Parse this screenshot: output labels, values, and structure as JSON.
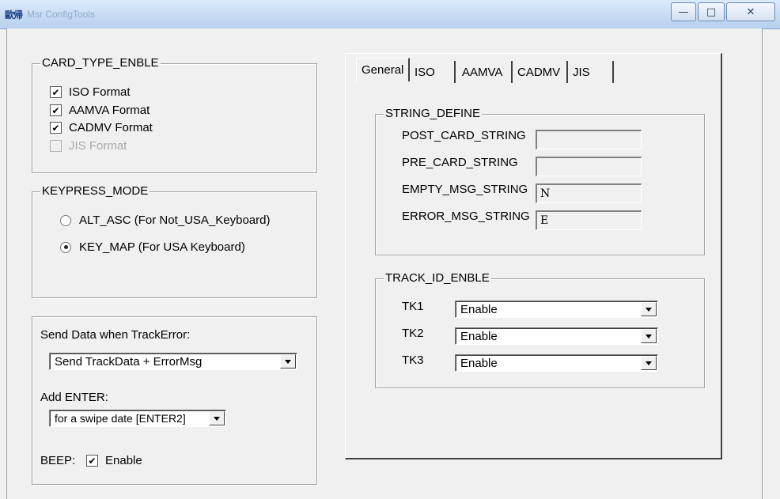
{
  "window": {
    "icon_text": "歐帰",
    "title": "Msr ConfigTools",
    "controls": {
      "minimize": "—",
      "maximize": "□",
      "close": "✕"
    }
  },
  "card_type": {
    "title": "CARD_TYPE_ENBLE",
    "items": [
      {
        "label": "ISO Format",
        "checked": true,
        "enabled": true
      },
      {
        "label": "AAMVA Format",
        "checked": true,
        "enabled": true
      },
      {
        "label": "CADMV Format",
        "checked": true,
        "enabled": true
      },
      {
        "label": "JIS Format",
        "checked": false,
        "enabled": false
      }
    ]
  },
  "keypress_mode": {
    "title": "KEYPRESS_MODE",
    "options": [
      {
        "label": "ALT_ASC (For Not_USA_Keyboard)",
        "selected": false
      },
      {
        "label": "KEY_MAP (For USA Keyboard)",
        "selected": true
      }
    ]
  },
  "send_data": {
    "label": "Send Data when TrackError:",
    "value": "Send TrackData + ErrorMsg",
    "enter_label": "Add ENTER:",
    "enter_value": "for a swipe date [ENTER2]",
    "beep_label": "BEEP:",
    "beep_option": "Enable",
    "beep_checked": true
  },
  "tabs": [
    {
      "label": "General",
      "active": true
    },
    {
      "label": "ISO",
      "active": false
    },
    {
      "label": "AAMVA",
      "active": false
    },
    {
      "label": "CADMV",
      "active": false
    },
    {
      "label": "JIS",
      "active": false
    }
  ],
  "string_define": {
    "title": "STRING_DEFINE",
    "rows": [
      {
        "label": "POST_CARD_STRING",
        "value": ""
      },
      {
        "label": "PRE_CARD_STRING",
        "value": ""
      },
      {
        "label": "EMPTY_MSG_STRING",
        "value": "N"
      },
      {
        "label": "ERROR_MSG_STRING",
        "value": "E"
      }
    ]
  },
  "track_id": {
    "title": "TRACK_ID_ENBLE",
    "rows": [
      {
        "label": "TK1",
        "value": "Enable"
      },
      {
        "label": "TK2",
        "value": "Enable"
      },
      {
        "label": "TK3",
        "value": "Enable"
      }
    ]
  }
}
